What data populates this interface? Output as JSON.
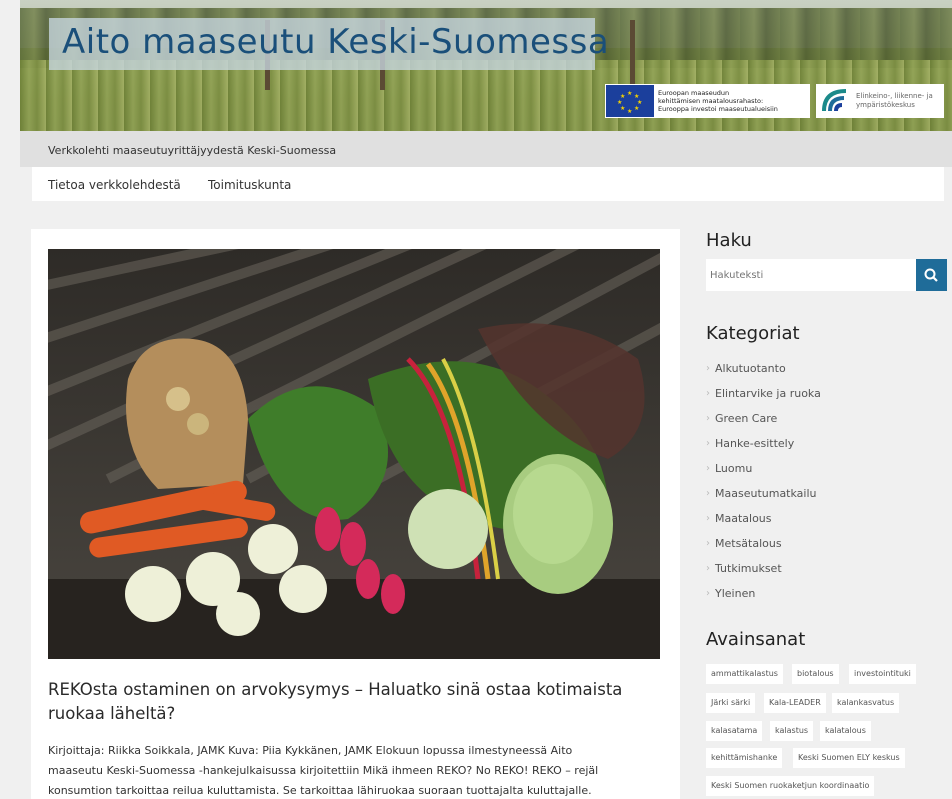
{
  "site": {
    "title": "Aito maaseutu Keski-Suomessa",
    "tagline": "Verkkolehti maaseutuyrittäjyydestä Keski-Suomessa",
    "eu_logo_text": [
      "Euroopan maaseudun",
      "kehittämisen maatalousrahasto:",
      "Eurooppa investoi maaseutualueisiin"
    ],
    "ely_logo_text": [
      "Elinkeino-, liikenne- ja",
      "ympäristökeskus"
    ]
  },
  "nav": {
    "items": [
      "Tietoa verkkolehdestä",
      "Toimituskunta"
    ]
  },
  "article": {
    "image_alt": "Vegetables: carrots, radishes, kohlrabi and chard on a wooden table",
    "title": "REKOsta ostaminen on arvokysymys – Haluatko sinä ostaa kotimaista ruokaa läheltä?",
    "excerpt_lines": [
      "Kirjoittaja: Riikka Soikkala, JAMK Kuva: Piia Kykkänen, JAMK Elokuun lopussa ilmestyneessä Aito",
      "maaseutu Keski-Suomessa -hankejulkaisussa kirjoitettiin Mikä ihmeen REKO? No REKO! REKO – rejäl",
      "konsumtion tarkoittaa reilua kuluttamista. Se tarkoittaa lähiruokaa suoraan tuottajalta kuluttajalle."
    ]
  },
  "sidebar": {
    "search": {
      "heading": "Haku",
      "placeholder": "Hakuteksti",
      "button_icon": "search-icon"
    },
    "categories": {
      "heading": "Kategoriat",
      "items": [
        "Alkutuotanto",
        "Elintarvike ja ruoka",
        "Green Care",
        "Hanke-esittely",
        "Luomu",
        "Maaseutumatkailu",
        "Maatalous",
        "Metsätalous",
        "Tutkimukset",
        "Yleinen"
      ]
    },
    "tags": {
      "heading": "Avainsanat",
      "items": [
        "ammattikalastus",
        "biotalous",
        "investointituki",
        "Järki särki",
        "Kala-LEADER",
        "kalankasvatus",
        "kalasatama",
        "kalastus",
        "kalatalous",
        "kehittämishanke",
        "Keski Suomen ELY keskus",
        "Keski Suomen ruokaketjun koordinaatio"
      ]
    }
  },
  "colors": {
    "accent": "#1f6c99",
    "title": "#1a4f7a"
  }
}
